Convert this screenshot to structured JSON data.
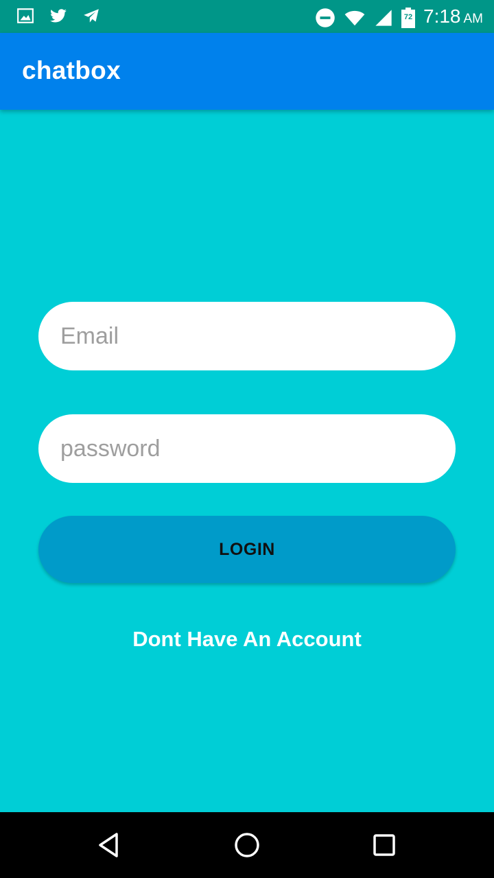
{
  "status_bar": {
    "time": "7:18",
    "ampm": "AM",
    "battery_level": "72",
    "icons": [
      "image-icon",
      "twitter-icon",
      "telegram-icon",
      "do-not-disturb-icon",
      "wifi-icon",
      "signal-icon",
      "battery-icon"
    ]
  },
  "app_bar": {
    "title": "chatbox"
  },
  "login_form": {
    "email_placeholder": "Email",
    "email_value": "",
    "password_placeholder": "password",
    "password_value": "",
    "login_label": "LOGIN",
    "signup_link": "Dont Have An Account"
  },
  "colors": {
    "status_bar": "#009688",
    "app_bar": "#0081ec",
    "background": "#00ced6",
    "button": "#009bc9"
  },
  "nav_bar": {
    "icons": [
      "back-icon",
      "home-icon",
      "recents-icon"
    ]
  }
}
